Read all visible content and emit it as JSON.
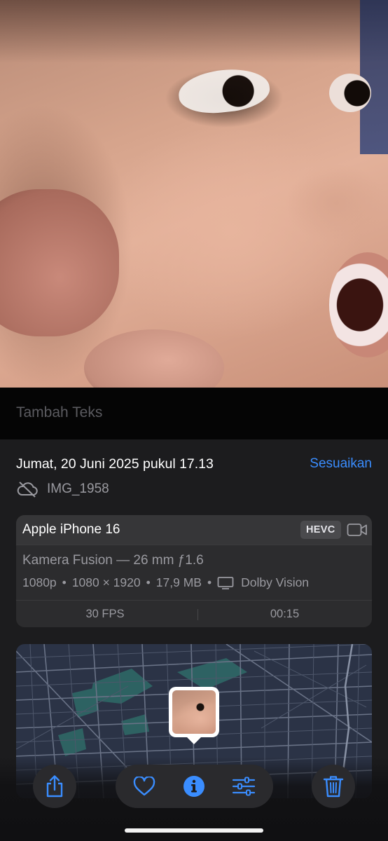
{
  "caption": {
    "placeholder": "Tambah Teks"
  },
  "info": {
    "date_time": "Jumat, 20 Juni 2025 pukul 17.13",
    "adjust_label": "Sesuaikan",
    "file_name": "IMG_1958"
  },
  "camera": {
    "device": "Apple iPhone 16",
    "format_badge": "HEVC",
    "lens": "Kamera Fusion — 26 mm ƒ1.6",
    "resolution": "1080p",
    "dimensions": "1080 × 1920",
    "size": "17,9 MB",
    "hdr": "Dolby Vision",
    "fps": "30 FPS",
    "duration": "00:15",
    "separator": "•"
  },
  "colors": {
    "accent": "#3a8dff",
    "panel_bg": "#1c1c1e",
    "card_bg": "#2c2c2e",
    "secondary_text": "#9a9aa0"
  },
  "toolbar": {
    "icons": [
      "share-icon",
      "heart-icon",
      "info-icon",
      "adjust-sliders-icon",
      "trash-icon"
    ]
  }
}
